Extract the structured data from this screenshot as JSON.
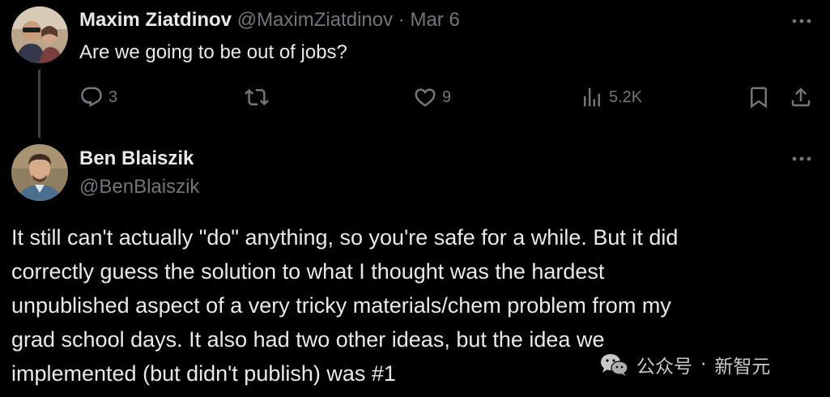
{
  "tweet1": {
    "author_name": "Maxim Ziatdinov",
    "handle": "@MaximZiatdinov",
    "separator": "·",
    "date": "Mar 6",
    "text": "Are we going to be out of jobs?",
    "stats": {
      "replies": "3",
      "likes": "9",
      "views": "5.2K"
    }
  },
  "tweet2": {
    "author_name": "Ben Blaiszik",
    "handle": "@BenBlaiszik",
    "text_lines": [
      "It still can't actually \"do\" anything, so you're safe for a while. But it did",
      "correctly guess the solution to what I thought was the hardest",
      "unpublished aspect of a very tricky materials/chem problem from my",
      "grad school days. It also had two other ideas, but the idea we",
      "implemented (but didn't publish) was #1"
    ]
  },
  "watermark": {
    "account_type": "公众号",
    "separator": "·",
    "account_name": "新智元"
  },
  "icons": {
    "reply": "reply-icon",
    "retweet": "retweet-icon",
    "like": "heart-icon",
    "views": "views-icon",
    "bookmark": "bookmark-icon",
    "share": "share-icon",
    "more": "more-icon",
    "watermark": "wechat-icon"
  },
  "colors": {
    "background": "#000000",
    "primary_text": "#e7e9ea",
    "secondary_text": "#71767b",
    "thread_line": "#3f4347"
  }
}
